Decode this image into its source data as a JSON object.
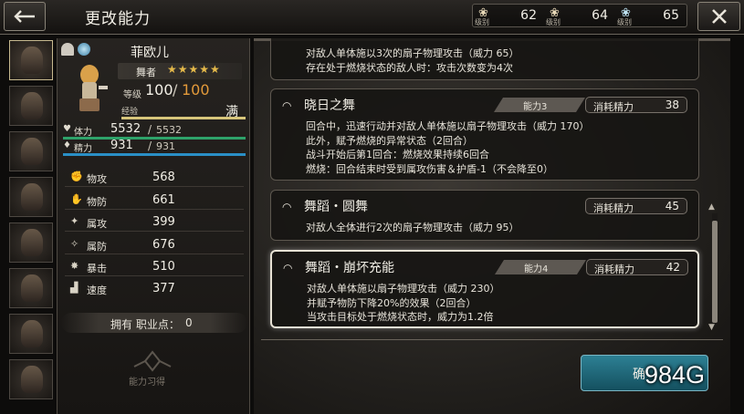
{
  "header": {
    "title": "更改能力",
    "currencies": [
      {
        "icon": "silver-crest-icon",
        "label": "级别",
        "value": "62"
      },
      {
        "icon": "gold-crest-icon",
        "label": "级别",
        "value": "64"
      },
      {
        "icon": "platinum-crest-icon",
        "label": "级别",
        "value": "65"
      }
    ]
  },
  "character": {
    "name": "菲欧儿",
    "job": "舞者",
    "stars": "★★★★★",
    "level_label": "等级",
    "level": "100",
    "level_sep": "/",
    "level_max": "100",
    "exp_label": "经验",
    "exp_value": "满",
    "hp_label": "体力",
    "hp": "5532",
    "hp_sep": "/",
    "hp_max": "5532",
    "sp_label": "精力",
    "sp": "931",
    "sp_sep": "/",
    "sp_max": "931",
    "stats": [
      {
        "label": "物攻",
        "value": "568"
      },
      {
        "label": "物防",
        "value": "661"
      },
      {
        "label": "属攻",
        "value": "399"
      },
      {
        "label": "属防",
        "value": "676"
      },
      {
        "label": "暴击",
        "value": "510"
      },
      {
        "label": "速度",
        "value": "377"
      }
    ],
    "job_points_label": "拥有 职业点：",
    "job_points": "0",
    "emblem_label": "能力习得"
  },
  "skills": {
    "partial": {
      "desc": [
        "对敌人单体施以3次的扇子物理攻击（威力 65）",
        "存在处于燃烧状态的敌人时：攻击次数变为4次"
      ]
    },
    "cards": [
      {
        "name": "晓日之舞",
        "req": "能力3",
        "cost_label": "消耗精力",
        "cost": "38",
        "desc": [
          "回合中，迅速行动并对敌人单体施以扇子物理攻击（威力 170）",
          "此外，赋予燃烧的异常状态（2回合）",
          "战斗开始后第1回合：燃烧效果持续6回合",
          "燃烧：回合结束时受到属攻伤害＆护盾-1（不会降至0）"
        ]
      },
      {
        "name": "舞蹈・圆舞",
        "req": "",
        "cost_label": "消耗精力",
        "cost": "45",
        "desc": [
          "对敌人全体进行2次的扇子物理攻击（威力 95）"
        ]
      },
      {
        "name": "舞蹈・崩坏充能",
        "req": "能力4",
        "cost_label": "消耗精力",
        "cost": "42",
        "desc": [
          "对敌人单体施以扇子物理攻击（威力 230）",
          "并赋予物防下降20%的效果（2回合）",
          "当攻击目标处于燃烧状态时，威力为1.2倍"
        ]
      }
    ]
  },
  "confirm_label": "确",
  "watermark": "984G",
  "colors": {
    "hp_bar": "#2ea36a",
    "sp_bar": "#2a8fc6",
    "max_level": "#e39a3a",
    "stars": "#e4b94a",
    "confirm": "#2d8094"
  }
}
